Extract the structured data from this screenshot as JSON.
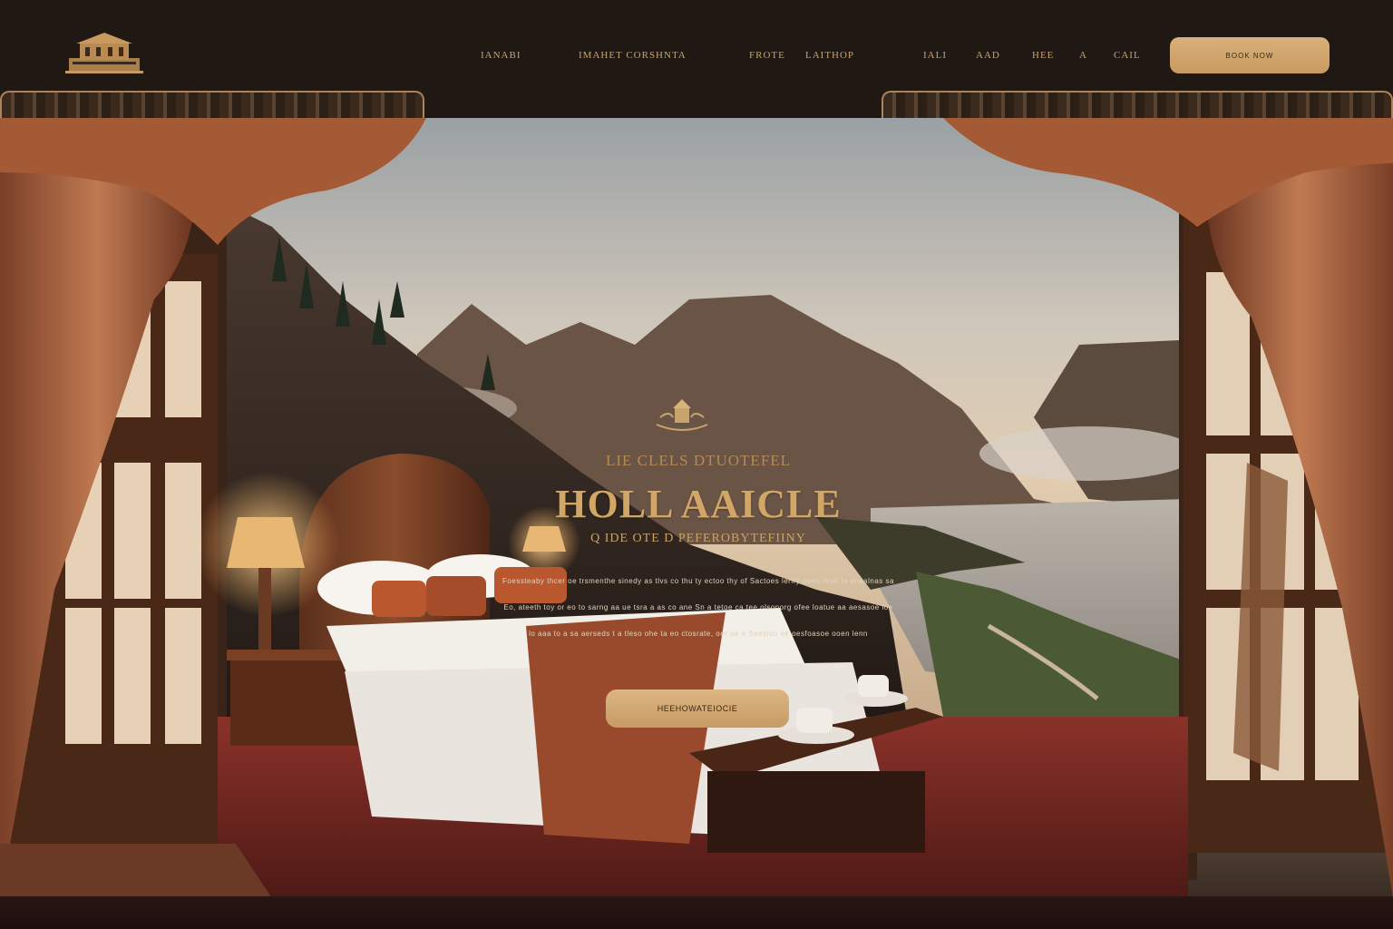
{
  "header": {
    "logo_icon": "hotel-building-icon",
    "nav": [
      "IANABI",
      "IMAHET CORSHNTA",
      "FROTE",
      "LAITHOP",
      "IALI",
      "AAD",
      "HEE",
      "A",
      "CAIL"
    ],
    "cta_label": "BOOK NOW"
  },
  "hero": {
    "crest_icon": "crown-crest-icon",
    "eyebrow": "LIE CLELS DTUOTEFEL",
    "title": "HOLL AAICLE",
    "subtitle": "Q  IDE  OTE  D  PEFEROBYTEFIINY",
    "body_lines": [
      "Foessteaby thcer oe trsmenthe sinedy as tlvs co thu ty ectoo thy of Sactoes lerlry oeeh tese te ensalnas sa",
      "Eo, ateeth toy or eo to sarng aa ue tsra a as co ane Sn a tetoe ca tee olsonorg ofee loatue aa aesasoe loe",
      "lo aaa to a sa aerseds t a tleso ohe ta eo ctosrate, oer ae e Seesloo ee oesfoasoe ooen lenn"
    ],
    "cta_label": "HEEHOWATEIOCIE"
  },
  "colors": {
    "header_bg": "#1f1813",
    "gold_accent": "#c9a46a",
    "button_gold": "#d9b17a",
    "curtain": "#b56a45",
    "carpet": "#7a2a23"
  }
}
